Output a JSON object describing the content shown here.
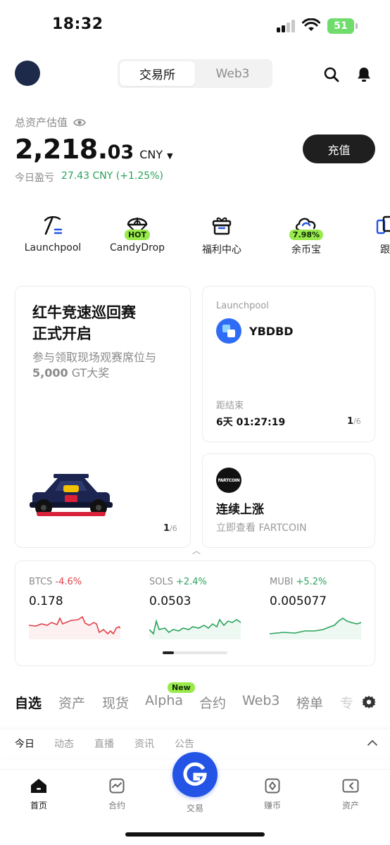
{
  "status_bar": {
    "time": "18:32",
    "battery": "51"
  },
  "header": {
    "tabs": [
      {
        "label": "交易所"
      },
      {
        "label": "Web3"
      }
    ]
  },
  "balance": {
    "label": "总资产估值",
    "amount_int": "2,218.",
    "amount_dec": "03",
    "currency": "CNY",
    "pnl_label": "今日盈亏",
    "pnl_value": "27.43 CNY",
    "pnl_pct": "(+1.25%)",
    "deposit_label": "充值"
  },
  "quick_actions": [
    {
      "label": "Launchpool",
      "icon": "pickaxe-icon"
    },
    {
      "label": "CandyDrop",
      "icon": "parachute-icon",
      "badge": "HOT"
    },
    {
      "label": "福利中心",
      "icon": "gift-icon"
    },
    {
      "label": "余币宝",
      "icon": "piggy-cloud-icon",
      "badge": "7.98%"
    },
    {
      "label": "跟",
      "icon": "copy-trade-icon"
    }
  ],
  "promo_card": {
    "title_line1": "红牛竞速巡回赛",
    "title_line2": "正式开启",
    "subtitle_prefix": "参与领取现场观赛席位与",
    "subtitle_amount": "5,000",
    "subtitle_suffix": " GT大奖",
    "page": "1",
    "page_total": "/6"
  },
  "launchpool_card": {
    "label": "Launchpool",
    "token": "YBDBD",
    "ends_label": "距结束",
    "timer": "6天 01:27:19",
    "page": "1",
    "page_total": "/6"
  },
  "fartcoin_card": {
    "logo_text": "FARTCOIN",
    "title": "连续上涨",
    "subtitle": "立即查看 FARTCOIN"
  },
  "tickers": [
    {
      "symbol": "BTCS",
      "change": "-4.6%",
      "price": "0.178",
      "color": "#e0424a"
    },
    {
      "symbol": "SOLS",
      "change": "+2.4%",
      "price": "0.0503",
      "color": "#2aa35b"
    },
    {
      "symbol": "MUBI",
      "change": "+5.2%",
      "price": "0.005077",
      "color": "#2aa35b"
    }
  ],
  "main_tabs": [
    {
      "label": "自选"
    },
    {
      "label": "资产"
    },
    {
      "label": "现货"
    },
    {
      "label": "Alpha"
    },
    {
      "label": "合约"
    },
    {
      "label": "Web3"
    },
    {
      "label": "榜单"
    },
    {
      "label": "专"
    }
  ],
  "new_badge": "New",
  "sub_tabs": [
    {
      "label": "今日"
    },
    {
      "label": "动态"
    },
    {
      "label": "直播"
    },
    {
      "label": "资讯"
    },
    {
      "label": "公告"
    }
  ],
  "bottom_nav": [
    {
      "label": "首页"
    },
    {
      "label": "合约"
    },
    {
      "label": "交易"
    },
    {
      "label": "赚币"
    },
    {
      "label": "资产"
    }
  ],
  "colors": {
    "positive": "#2aa35b",
    "negative": "#e0424a",
    "accent": "#2354e6",
    "badge": "#9aea4d"
  }
}
